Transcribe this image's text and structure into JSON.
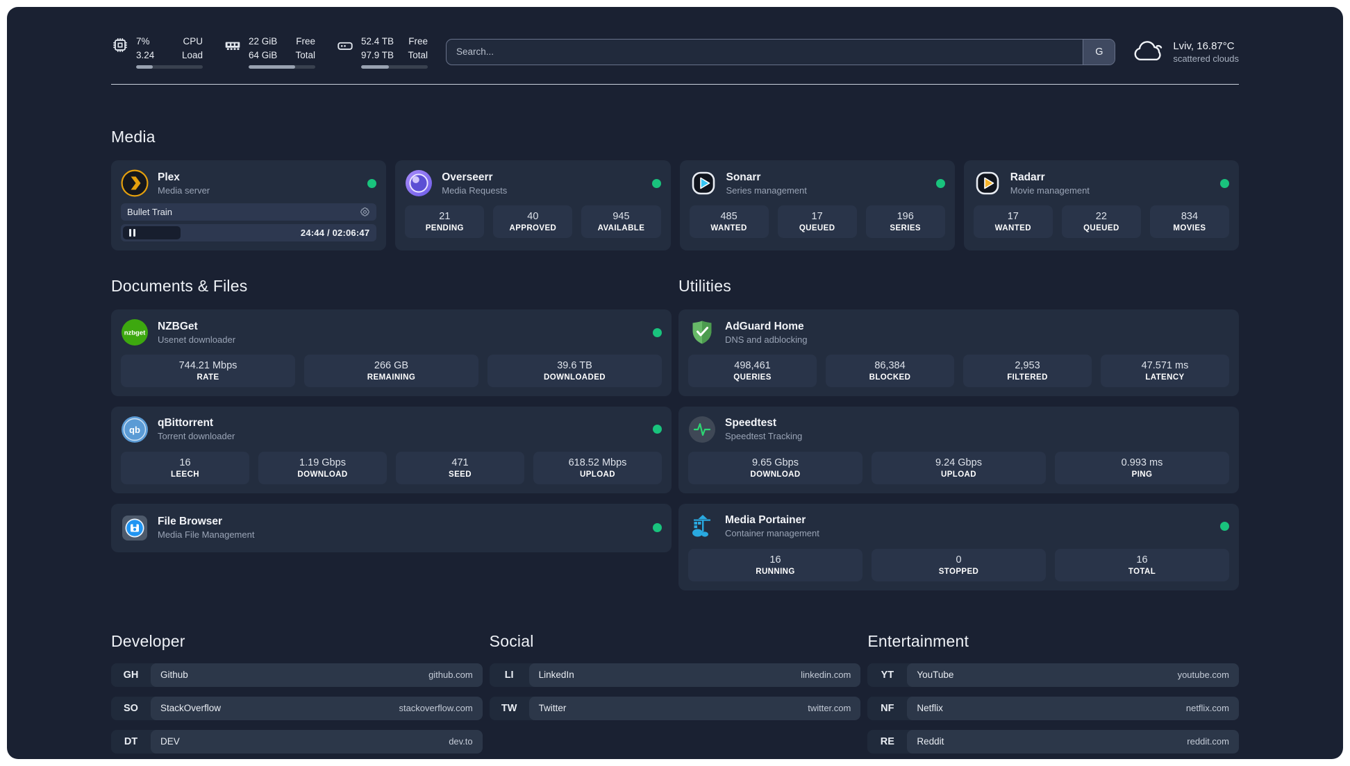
{
  "colors": {
    "status_online": "#19c37d",
    "plex_accent": "#e5a00d"
  },
  "topbar": {
    "cpu": {
      "v1": "7%",
      "v2": "3.24",
      "l1": "CPU",
      "l2": "Load",
      "progress": 25
    },
    "memory": {
      "v1": "22 GiB",
      "v2": "64 GiB",
      "l1": "Free",
      "l2": "Total",
      "progress": 70
    },
    "disk": {
      "v1": "52.4 TB",
      "v2": "97.9 TB",
      "l1": "Free",
      "l2": "Total",
      "progress": 42
    },
    "search": {
      "placeholder": "Search...",
      "button_label": "G"
    },
    "weather": {
      "location": "Lviv, 16.87°C",
      "condition": "scattered clouds"
    }
  },
  "media": {
    "title": "Media",
    "cards": [
      {
        "name": "Plex",
        "description": "Media server",
        "online": true,
        "player": {
          "title": "Bullet Train",
          "progress": 20,
          "time": "24:44 / 02:06:47"
        }
      },
      {
        "name": "Overseerr",
        "description": "Media Requests",
        "online": true,
        "stats": [
          {
            "value": "21",
            "label": "PENDING"
          },
          {
            "value": "40",
            "label": "APPROVED"
          },
          {
            "value": "945",
            "label": "AVAILABLE"
          }
        ]
      },
      {
        "name": "Sonarr",
        "description": "Series management",
        "online": true,
        "stats": [
          {
            "value": "485",
            "label": "WANTED"
          },
          {
            "value": "17",
            "label": "QUEUED"
          },
          {
            "value": "196",
            "label": "SERIES"
          }
        ]
      },
      {
        "name": "Radarr",
        "description": "Movie management",
        "online": true,
        "stats": [
          {
            "value": "17",
            "label": "WANTED"
          },
          {
            "value": "22",
            "label": "QUEUED"
          },
          {
            "value": "834",
            "label": "MOVIES"
          }
        ]
      }
    ]
  },
  "documents": {
    "title": "Documents & Files",
    "cards": [
      {
        "name": "NZBGet",
        "description": "Usenet downloader",
        "online": true,
        "stats": [
          {
            "value": "744.21 Mbps",
            "label": "RATE"
          },
          {
            "value": "266 GB",
            "label": "REMAINING"
          },
          {
            "value": "39.6 TB",
            "label": "DOWNLOADED"
          }
        ]
      },
      {
        "name": "qBittorrent",
        "description": "Torrent downloader",
        "online": true,
        "stats": [
          {
            "value": "16",
            "label": "LEECH"
          },
          {
            "value": "1.19 Gbps",
            "label": "DOWNLOAD"
          },
          {
            "value": "471",
            "label": "SEED"
          },
          {
            "value": "618.52 Mbps",
            "label": "UPLOAD"
          }
        ]
      },
      {
        "name": "File Browser",
        "description": "Media File Management",
        "online": true
      }
    ]
  },
  "utilities": {
    "title": "Utilities",
    "cards": [
      {
        "name": "AdGuard Home",
        "description": "DNS and adblocking",
        "stats": [
          {
            "value": "498,461",
            "label": "QUERIES"
          },
          {
            "value": "86,384",
            "label": "BLOCKED"
          },
          {
            "value": "2,953",
            "label": "FILTERED"
          },
          {
            "value": "47.571 ms",
            "label": "LATENCY"
          }
        ]
      },
      {
        "name": "Speedtest",
        "description": "Speedtest Tracking",
        "stats": [
          {
            "value": "9.65 Gbps",
            "label": "DOWNLOAD"
          },
          {
            "value": "9.24 Gbps",
            "label": "UPLOAD"
          },
          {
            "value": "0.993 ms",
            "label": "PING"
          }
        ]
      },
      {
        "name": "Media Portainer",
        "description": "Container management",
        "online": true,
        "stats": [
          {
            "value": "16",
            "label": "RUNNING"
          },
          {
            "value": "0",
            "label": "STOPPED"
          },
          {
            "value": "16",
            "label": "TOTAL"
          }
        ]
      }
    ]
  },
  "bookmarks": [
    {
      "title": "Developer",
      "items": [
        {
          "abbr": "GH",
          "name": "Github",
          "url": "github.com"
        },
        {
          "abbr": "SO",
          "name": "StackOverflow",
          "url": "stackoverflow.com"
        },
        {
          "abbr": "DT",
          "name": "DEV",
          "url": "dev.to"
        }
      ]
    },
    {
      "title": "Social",
      "items": [
        {
          "abbr": "LI",
          "name": "LinkedIn",
          "url": "linkedin.com"
        },
        {
          "abbr": "TW",
          "name": "Twitter",
          "url": "twitter.com"
        }
      ]
    },
    {
      "title": "Entertainment",
      "items": [
        {
          "abbr": "YT",
          "name": "YouTube",
          "url": "youtube.com"
        },
        {
          "abbr": "NF",
          "name": "Netflix",
          "url": "netflix.com"
        },
        {
          "abbr": "RE",
          "name": "Reddit",
          "url": "reddit.com"
        }
      ]
    }
  ]
}
